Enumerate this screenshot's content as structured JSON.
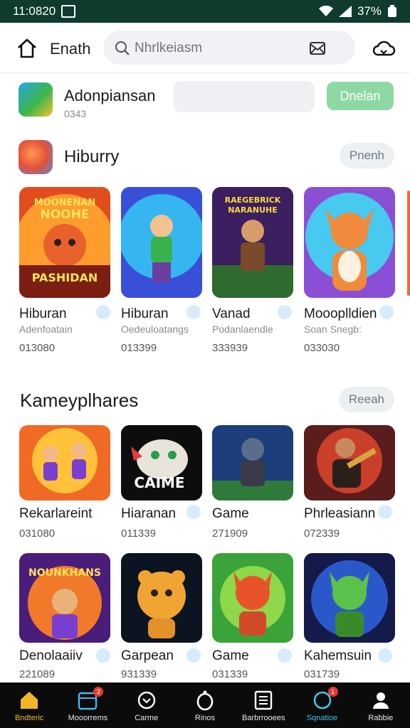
{
  "status": {
    "time": "11:0820",
    "battery": "37%"
  },
  "header": {
    "title": "Enath",
    "search_placeholder": "Nhrlkeiasm"
  },
  "featured": {
    "name": "Adonpiansan",
    "sub": "0343",
    "button": "Dnelan"
  },
  "section1": {
    "title": "Hiburry",
    "more": "Pnenh",
    "cards": [
      {
        "name": "Hiburan",
        "sub": "Adenfoatain",
        "num": "013080",
        "art": "MOONENAN NOOHE / PASHIDAN",
        "verified": true
      },
      {
        "name": "Hiburan",
        "sub": "Oedeuloatangs",
        "num": "013399",
        "art": "",
        "verified": true
      },
      {
        "name": "Vanad",
        "sub": "Podanlaendle",
        "num": "333939",
        "art": "RAEGEBRICK NARANUHE",
        "verified": true
      },
      {
        "name": "Moooplldien",
        "sub": "Soan Snegb:",
        "num": "033030",
        "art": "",
        "verified": true
      }
    ]
  },
  "section2": {
    "title": "Kameyplhares",
    "more": "Reeah",
    "cards": [
      {
        "name": "Rekarlareint",
        "num": "031080",
        "art": "",
        "verified": false
      },
      {
        "name": "Hiaranan",
        "num": "011339",
        "art": "CAIME",
        "verified": true
      },
      {
        "name": "Game",
        "num": "271909",
        "art": "",
        "verified": false
      },
      {
        "name": "Phrleasiann",
        "num": "072339",
        "art": "",
        "verified": true
      }
    ]
  },
  "section3": {
    "cards": [
      {
        "name": "Denolaaiiv",
        "num": "221089",
        "art": "NOUNKHANS",
        "verified": true
      },
      {
        "name": "Garpean",
        "num": "931339",
        "art": "",
        "verified": true
      },
      {
        "name": "Game",
        "num": "031339",
        "art": "",
        "verified": true
      },
      {
        "name": "Kahemsuin",
        "num": "031739",
        "art": "",
        "verified": true
      }
    ]
  },
  "nav": [
    {
      "label": "Bndteric",
      "icon": "home-icon",
      "active": true
    },
    {
      "label": "Mooorrems",
      "icon": "calendar-icon",
      "badge": "2"
    },
    {
      "label": "Carme",
      "icon": "gamepad-icon"
    },
    {
      "label": "Rinos",
      "icon": "ring-icon"
    },
    {
      "label": "Barbrrooees",
      "icon": "list-icon"
    },
    {
      "label": "Sqnatioe",
      "icon": "sync-icon",
      "badge": "1"
    },
    {
      "label": "Rabbie",
      "icon": "profile-icon"
    }
  ],
  "colors": {
    "status_bg": "#0f3b2f",
    "accent_green": "#8ed8a4",
    "nav_active": "#f1b729",
    "verify": "#45a8ea"
  }
}
